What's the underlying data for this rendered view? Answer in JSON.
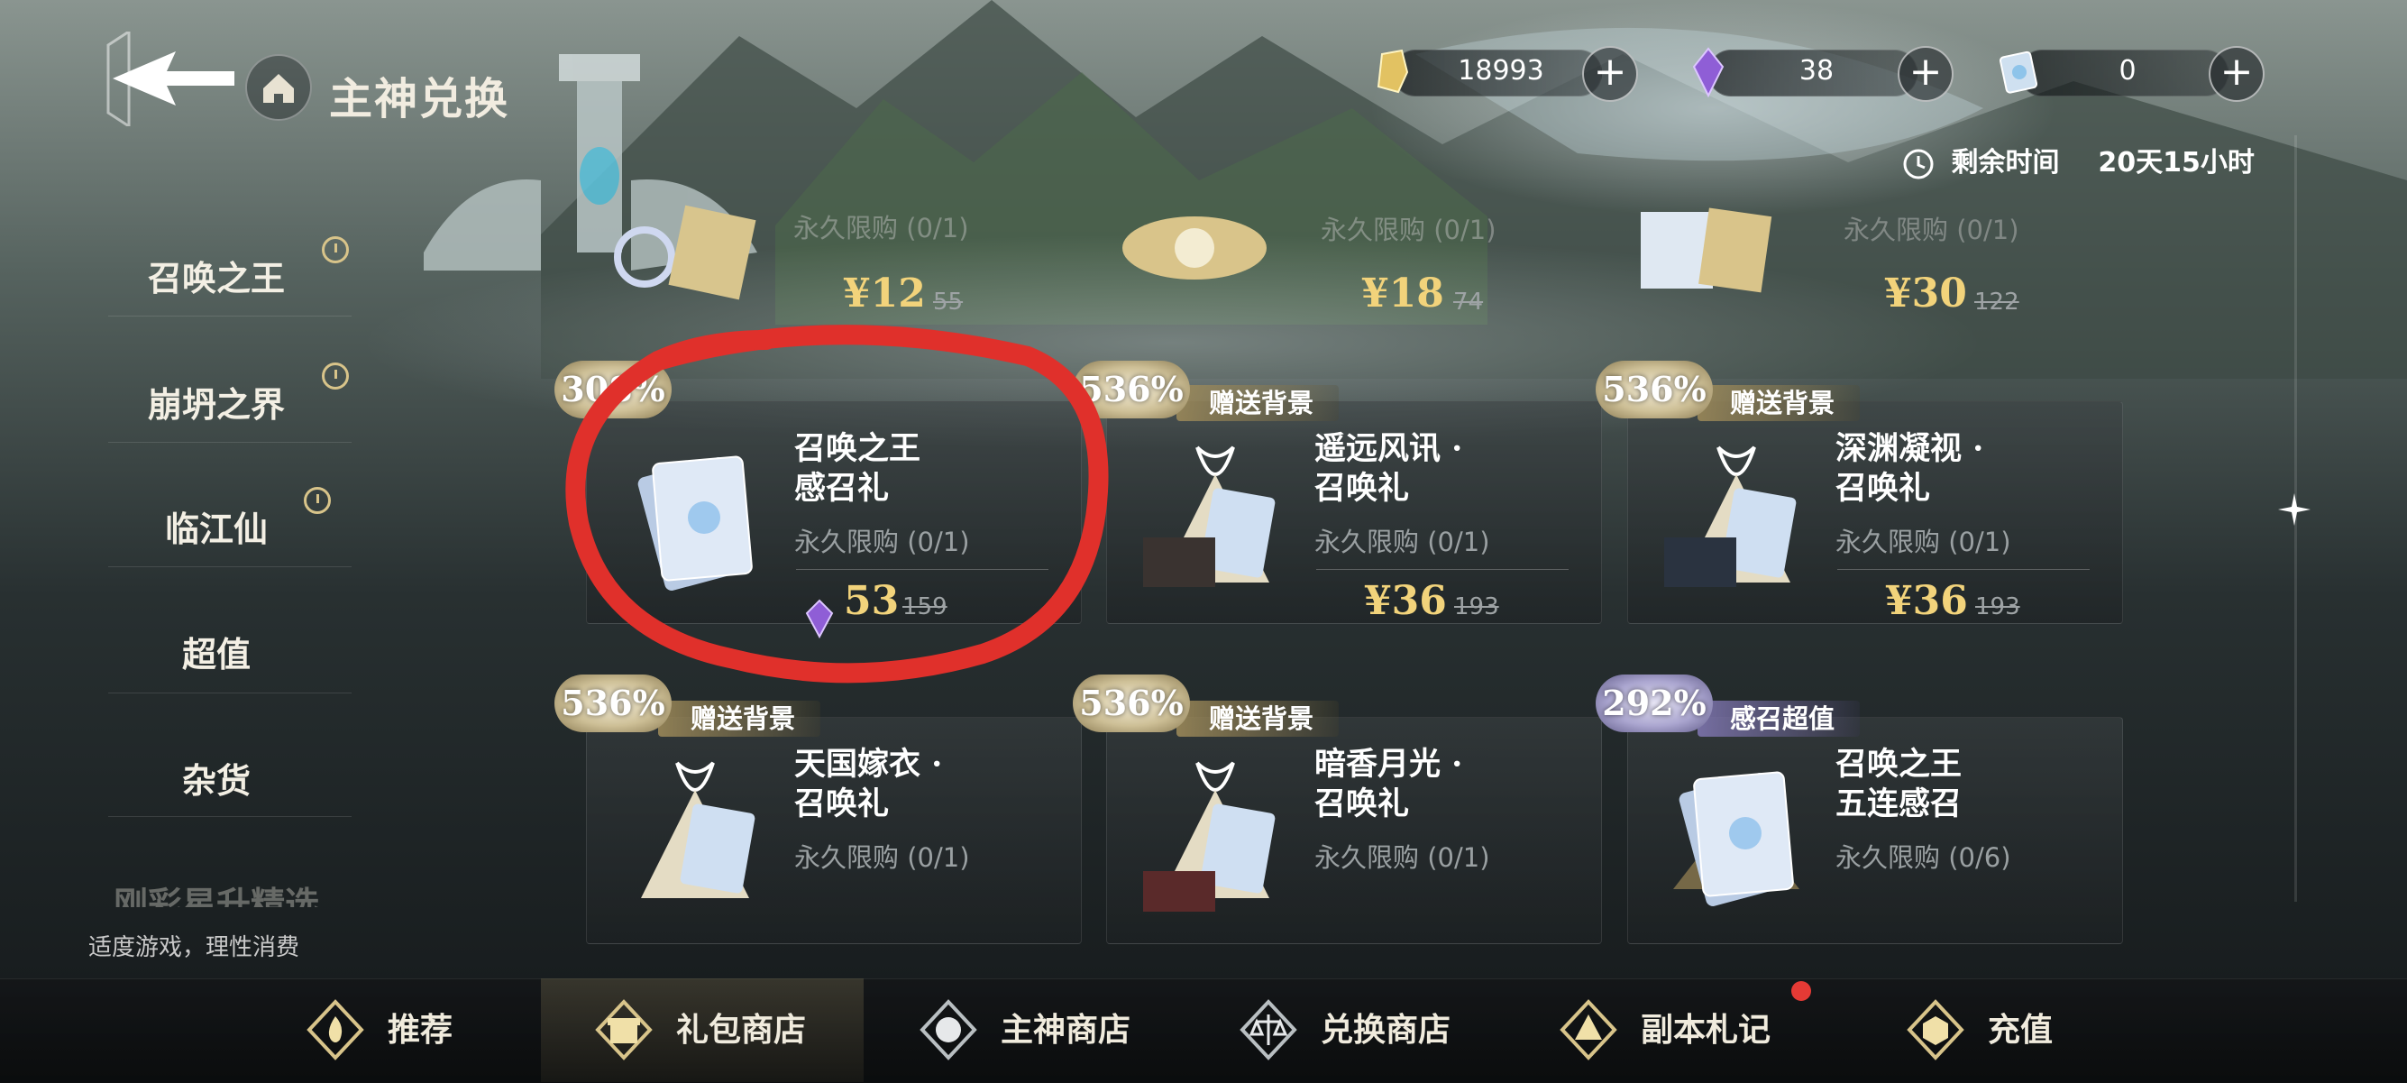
{
  "header": {
    "title": "主神兑换"
  },
  "currencies": [
    {
      "icon": "gold-crystal-icon",
      "value": "18993"
    },
    {
      "icon": "purple-crystal-icon",
      "value": "38"
    },
    {
      "icon": "blue-card-icon",
      "value": "0"
    }
  ],
  "timer": {
    "label": "剩余时间",
    "value": "20天15小时"
  },
  "sidebar": {
    "items": [
      {
        "label": "召唤之王",
        "timed": true
      },
      {
        "label": "崩坍之界",
        "timed": true
      },
      {
        "label": "临江仙",
        "timed": true
      },
      {
        "label": "超值",
        "timed": false
      },
      {
        "label": "杂货",
        "timed": false
      },
      {
        "label": "刚彩星升精选",
        "timed": false
      }
    ],
    "tip": "适度游戏，理性消费"
  },
  "top_row": [
    {
      "limit": "永久限购 (0/1)",
      "price": "¥12",
      "orig": "55"
    },
    {
      "limit": "永久限购 (0/1)",
      "price": "¥18",
      "orig": "74"
    },
    {
      "limit": "永久限购 (0/1)",
      "price": "¥30",
      "orig": "122"
    }
  ],
  "cards": [
    {
      "badge": "308%",
      "tag": "",
      "name1": "召唤之王",
      "name2": "感召礼",
      "limit": "永久限购 (0/1)",
      "price": "53",
      "orig": "159",
      "currency": "purple"
    },
    {
      "badge": "536%",
      "tag": "赠送背景",
      "name1": "遥远风讯 ·",
      "name2": "召唤礼",
      "limit": "永久限购 (0/1)",
      "price": "¥36",
      "orig": "193",
      "currency": "rmb"
    },
    {
      "badge": "536%",
      "tag": "赠送背景",
      "name1": "深渊凝视 ·",
      "name2": "召唤礼",
      "limit": "永久限购 (0/1)",
      "price": "¥36",
      "orig": "193",
      "currency": "rmb"
    },
    {
      "badge": "536%",
      "tag": "赠送背景",
      "name1": "天国嫁衣 ·",
      "name2": "召唤礼",
      "limit": "永久限购 (0/1)"
    },
    {
      "badge": "536%",
      "tag": "赠送背景",
      "name1": "暗香月光 ·",
      "name2": "召唤礼",
      "limit": "永久限购 (0/1)"
    },
    {
      "badge": "292%",
      "tag": "感召超值",
      "name1": "召唤之王",
      "name2": "五连感召",
      "limit": "永久限购 (0/6)"
    }
  ],
  "nav": {
    "items": [
      {
        "label": "推荐",
        "icon": "flame-icon"
      },
      {
        "label": "礼包商店",
        "icon": "gift-icon",
        "active": true
      },
      {
        "label": "主神商店",
        "icon": "coin-icon"
      },
      {
        "label": "兑换商店",
        "icon": "scale-icon"
      },
      {
        "label": "副本札记",
        "icon": "triforce-icon"
      },
      {
        "label": "充值",
        "icon": "cube-icon"
      }
    ]
  },
  "colors": {
    "price_gold": "#f2d37b",
    "annotation_red": "#e0302b",
    "badge_gold": "#cdbf96",
    "badge_purple": "#aba6d0"
  }
}
